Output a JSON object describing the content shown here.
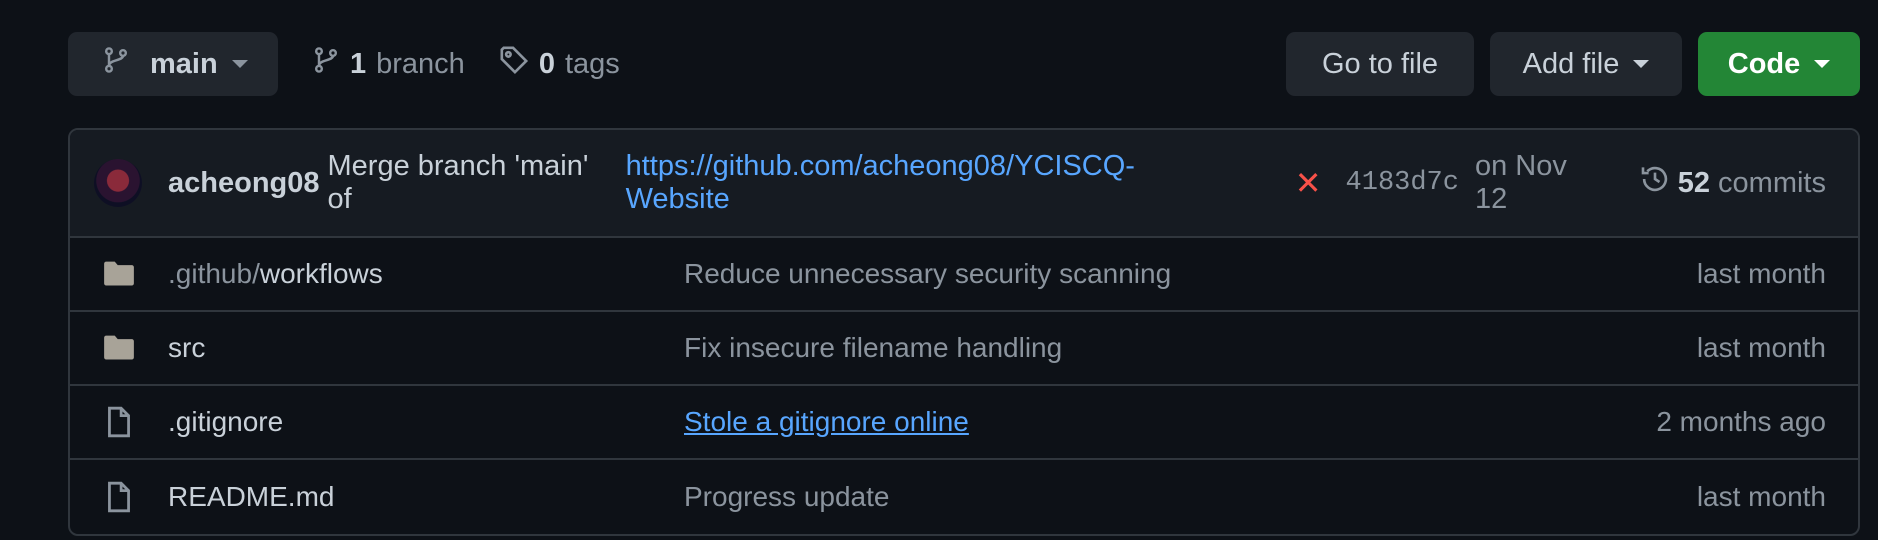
{
  "toolbar": {
    "branch_select": "main",
    "branch_count": "1",
    "branch_label": "branch",
    "tag_count": "0",
    "tag_label": "tags",
    "goto_file": "Go to file",
    "add_file": "Add file",
    "code": "Code"
  },
  "latest_commit": {
    "author": "acheong08",
    "message": "Merge branch 'main' of",
    "url": "https://github.com/acheong08/YCISCQ-Website",
    "status_icon": "x-icon",
    "sha": "4183d7c",
    "date": "on Nov 12",
    "commit_count": "52",
    "commit_label": "commits"
  },
  "files": [
    {
      "type": "folder",
      "name_prefix": ".github/",
      "name": "workflows",
      "message": "Reduce unnecessary security scanning",
      "time": "last month"
    },
    {
      "type": "folder",
      "name_prefix": "",
      "name": "src",
      "message": "Fix insecure filename handling",
      "time": "last month"
    },
    {
      "type": "file",
      "name_prefix": "",
      "name": ".gitignore",
      "message": "Stole a gitignore online",
      "time": "2 months ago"
    },
    {
      "type": "file",
      "name_prefix": "",
      "name": "README.md",
      "message": "Progress update",
      "time": "last month"
    }
  ],
  "colors": {
    "background": "#0d1117",
    "button": "#21262d",
    "code_button": "#238636",
    "link": "#58a6ff",
    "failure": "#f85149"
  }
}
